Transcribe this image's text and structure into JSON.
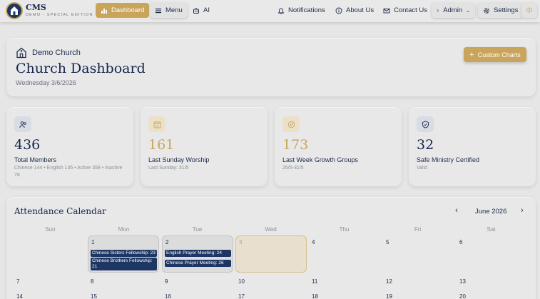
{
  "app": {
    "title": "CMS",
    "subtitle": "DEMO - SPECIAL EDITION"
  },
  "nav": {
    "dashboard": "Dashboard",
    "menu": "Menu",
    "ai": "AI",
    "notifications": "Notifications",
    "about": "About Us",
    "contact": "Contact Us",
    "admin": "Admin",
    "settings": "Settings",
    "language": "中"
  },
  "header": {
    "church_name": "Demo Church",
    "title": "Church Dashboard",
    "date": "Wednesday 3/6/2026",
    "custom_charts": "Custom Charts"
  },
  "stats": [
    {
      "value": "436",
      "label": "Total Members",
      "sub": "Chinese 144  •  English 135  •  Active 358  •  Inactive 78",
      "icon": "users-icon"
    },
    {
      "value": "161",
      "label": "Last Sunday Worship",
      "sub": "Last Sunday: 31/5",
      "icon": "calendar-check-icon"
    },
    {
      "value": "173",
      "label": "Last Week Growth Groups",
      "sub": "25/5-31/5",
      "icon": "compass-icon"
    },
    {
      "value": "32",
      "label": "Safe Ministry Certified",
      "sub": "Valid",
      "icon": "shield-check-icon"
    }
  ],
  "calendar": {
    "title": "Attendance Calendar",
    "month": "June 2026",
    "weekdays": [
      "Sun",
      "Mon",
      "Tue",
      "Wed",
      "Thu",
      "Fri",
      "Sat"
    ],
    "week1": {
      "mon": {
        "day": "1",
        "events": [
          "Chinese Sisters Fellowship: 23",
          "Chinese Brothers Fellowship: 21"
        ]
      },
      "tue": {
        "day": "2",
        "events": [
          "English Prayer Meeting: 24",
          "Chinese Prayer Meeting: 26"
        ]
      },
      "wed": {
        "day": "3"
      },
      "thu": "4",
      "fri": "5",
      "sat": "6"
    },
    "week2": [
      "7",
      "8",
      "9",
      "10",
      "11",
      "12",
      "13"
    ],
    "week3": [
      "14",
      "15",
      "16",
      "17",
      "18",
      "19",
      "20"
    ]
  },
  "colors": {
    "accent": "#c9a55c",
    "navy": "#1e3663",
    "background": "#e6e6e6"
  }
}
